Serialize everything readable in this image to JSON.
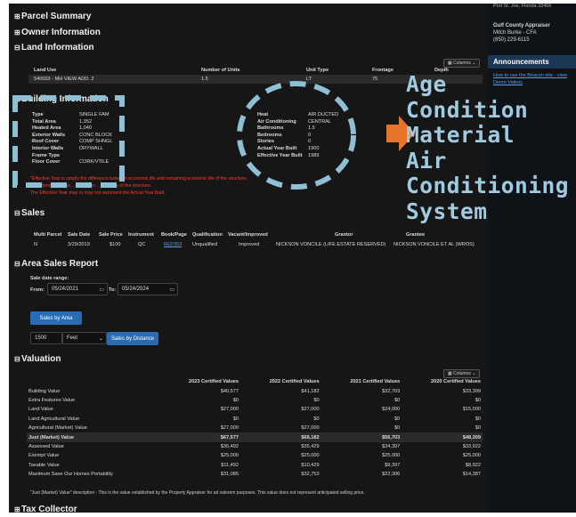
{
  "sidebar": {
    "address": "Port St. Joe, Florida 32456",
    "appraiser_title": "Gulf County Appraiser",
    "appraiser_name": "Mitch Burke - CFA",
    "appraiser_phone": "(850) 229-6115",
    "announcements_title": "Announcements",
    "link1": "How to use the Beacon site - view",
    "link2": "Demo Videos"
  },
  "sections": {
    "parcel_summary": "Parcel Summary",
    "owner_information": "Owner Information",
    "land_information": "Land Information",
    "building_information": "Building Information",
    "sales": "Sales",
    "area_sales_report": "Area Sales Report",
    "valuation": "Valuation",
    "tax_collector": "Tax Collector"
  },
  "columns_label": "Columns",
  "land": {
    "headers": [
      "Land Use",
      "Number of Units",
      "Unit Type",
      "Frontage",
      "Depth"
    ],
    "row": [
      "540003 - MH VIEW ADD. 2",
      "1.5",
      "LT",
      "75",
      ""
    ]
  },
  "building": {
    "left": [
      {
        "label": "Type",
        "value": "SINGLE FAM"
      },
      {
        "label": "Total Area",
        "value": "1,352"
      },
      {
        "label": "Heated Area",
        "value": "1,040"
      },
      {
        "label": "Exterior Walls",
        "value": "CONC BLOCK"
      },
      {
        "label": "Roof Cover",
        "value": "COMP SHNGL"
      },
      {
        "label": "Interior Walls",
        "value": "DRYWALL"
      },
      {
        "label": "Frame Type",
        "value": ""
      },
      {
        "label": "Floor Cover",
        "value": "CORK/VTILE"
      }
    ],
    "right": [
      {
        "label": "Heat",
        "value": "AIR DUCTED"
      },
      {
        "label": "Air Conditioning",
        "value": "CENTRAL"
      },
      {
        "label": "Bathrooms",
        "value": "1.5"
      },
      {
        "label": "Bedrooms",
        "value": "0"
      },
      {
        "label": "Stories",
        "value": "0"
      },
      {
        "label": "Actual Year Built",
        "value": "1900"
      },
      {
        "label": "Effective Year Built",
        "value": "1989"
      }
    ],
    "note1": "*Effective Year is simply the difference between economic life and remaining economic life of the structure.",
    "note2": "... evidenced by the ... condition ... usability of the structure.",
    "note3": "The Effective Year may or may not represent the Actual Year Built."
  },
  "sales": {
    "headers": [
      "Multi Parcel",
      "Sale Date",
      "Sale Price",
      "Instrument",
      "Book/Page",
      "Qualification",
      "Vacant/Improved",
      "Grantor",
      "Grantee"
    ],
    "row": [
      "N",
      "3/29/2019",
      "$100",
      "QC",
      "662/353",
      "Unqualified",
      "Improved",
      "NICKSON VONCILE (LIFE ESTATE RESERVED)",
      "NICKSON VONCILE ET AL (WROS)"
    ]
  },
  "area_sales": {
    "range_label": "Sale date range:",
    "from_label": "From:",
    "from_value": "05/24/2021",
    "to_label": "To:",
    "to_value": "05/24/2024",
    "sales_by_area": "Sales by Area",
    "distance_value": "1500",
    "unit_value": "Feet",
    "sales_by_distance": "Sales by Distance"
  },
  "valuation": {
    "headers": [
      "",
      "2023 Certified Values",
      "2022 Certified Values",
      "2021 Certified Values",
      "2020 Certified Values"
    ],
    "rows": [
      [
        "Building Value",
        "$40,577",
        "$41,182",
        "$32,703",
        "$33,309"
      ],
      [
        "Extra Features Value",
        "$0",
        "$0",
        "$0",
        "$0"
      ],
      [
        "Land Value",
        "$27,000",
        "$27,000",
        "$24,000",
        "$15,000"
      ],
      [
        "Land Agricultural Value",
        "$0",
        "$0",
        "$0",
        "$0"
      ],
      [
        "Agricultural (Market) Value",
        "$27,000",
        "$27,000",
        "$0",
        "$0"
      ],
      [
        "Just (Market) Value",
        "$67,577",
        "$68,182",
        "$56,703",
        "$48,309"
      ],
      [
        "Assessed Value",
        "$36,492",
        "$35,429",
        "$34,397",
        "$33,922"
      ],
      [
        "Exempt Value",
        "$25,000",
        "$25,000",
        "$25,000",
        "$25,000"
      ],
      [
        "Taxable Value",
        "$11,492",
        "$10,429",
        "$9,397",
        "$8,922"
      ],
      [
        "Maximum Save Our Homes Portability",
        "$31,085",
        "$32,753",
        "$22,306",
        "$14,387"
      ]
    ],
    "footnote": "\"Just (Market) Value\" description - This is the value established by the Property Appraiser for ad valorem purposes. This value does not represent anticipated selling price."
  },
  "overlay": {
    "lines": [
      "Age",
      "Condition",
      "Material",
      "Air",
      "Conditioning",
      "System"
    ]
  },
  "colors": {
    "overlay_dash": "#8fbfd4",
    "arrow": "#e8732a",
    "button": "#2a6cb3"
  }
}
